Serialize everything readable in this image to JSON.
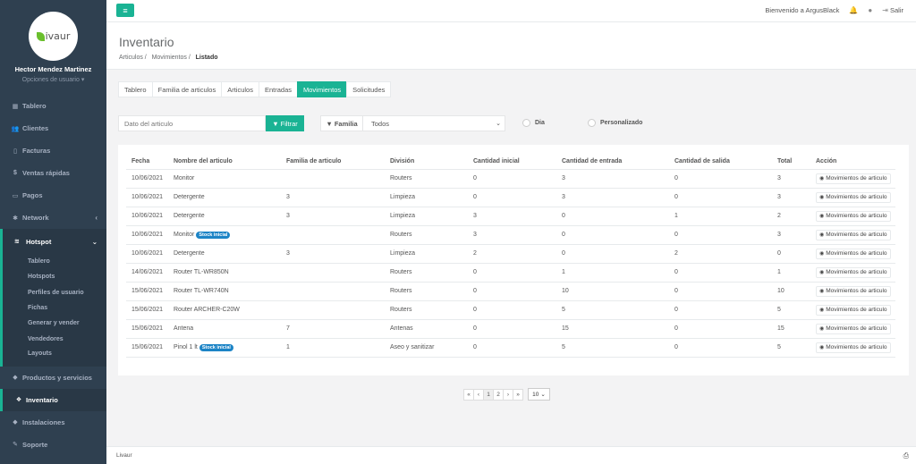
{
  "brand": {
    "logo_text": "ivaur",
    "footer_text": "Livaur"
  },
  "user": {
    "name": "Hector Mendez Martinez",
    "options": "Opciones de usuario"
  },
  "sidebar": {
    "items_top": [
      {
        "label": "Tablero",
        "icon": "dashboard-icon"
      },
      {
        "label": "Clientes",
        "icon": "users-icon"
      },
      {
        "label": "Facturas",
        "icon": "file-icon"
      },
      {
        "label": "Ventas rápidas",
        "icon": "dollar-icon"
      },
      {
        "label": "Pagos",
        "icon": "money-icon"
      },
      {
        "label": "Network",
        "icon": "network-icon"
      }
    ],
    "hotspot": {
      "label": "Hotspot",
      "sub_items": [
        "Tablero",
        "Hotspots",
        "Perfiles de usuario",
        "Fichas",
        "Generar y vender",
        "Vendedores",
        "Layouts"
      ]
    },
    "items_bottom": [
      {
        "label": "Productos y servicios",
        "icon": "tag-icon"
      },
      {
        "label": "Inventario",
        "icon": "cubes-icon",
        "active": true
      },
      {
        "label": "Instalaciones",
        "icon": "tag-icon"
      },
      {
        "label": "Soporte",
        "icon": "wrench-icon"
      }
    ]
  },
  "topbar": {
    "welcome": "Bienvenido a ArgusBlack",
    "logout": "Salir"
  },
  "header": {
    "title": "Inventario",
    "breadcrumb": [
      "Articulos",
      "Movimientos",
      "Listado"
    ]
  },
  "tabs": [
    {
      "label": "Tablero"
    },
    {
      "label": "Familia de articulos"
    },
    {
      "label": "Articulos"
    },
    {
      "label": "Entradas"
    },
    {
      "label": "Movimientos",
      "active": true
    },
    {
      "label": "Solicitudes"
    }
  ],
  "filters": {
    "search_placeholder": "Dato del articulo",
    "filter_button": "Filtrar",
    "family_label": "Familia",
    "family_value": "Todos",
    "radio_day": "Dia",
    "radio_custom": "Personalizado"
  },
  "table": {
    "columns": [
      "Fecha",
      "Nombre del articulo",
      "Familia de articulo",
      "División",
      "Cantidad inicial",
      "Cantidad de entrada",
      "Cantidad de salida",
      "Total",
      "Acción"
    ],
    "action_label": "Movimientos de articulo",
    "rows": [
      {
        "fecha": "10/06/2021",
        "nombre": "Monitor",
        "badge": "",
        "familia": "",
        "division": "Routers",
        "inicial": "0",
        "entrada": "3",
        "salida": "0",
        "total": "3"
      },
      {
        "fecha": "10/06/2021",
        "nombre": "Detergente",
        "badge": "",
        "familia": "3",
        "division": "Limpieza",
        "inicial": "0",
        "entrada": "3",
        "salida": "0",
        "total": "3"
      },
      {
        "fecha": "10/06/2021",
        "nombre": "Detergente",
        "badge": "",
        "familia": "3",
        "division": "Limpieza",
        "inicial": "3",
        "entrada": "0",
        "salida": "1",
        "total": "2"
      },
      {
        "fecha": "10/06/2021",
        "nombre": "Monitor",
        "badge": "Stock inicial",
        "familia": "",
        "division": "Routers",
        "inicial": "3",
        "entrada": "0",
        "salida": "0",
        "total": "3"
      },
      {
        "fecha": "10/06/2021",
        "nombre": "Detergente",
        "badge": "",
        "familia": "3",
        "division": "Limpieza",
        "inicial": "2",
        "entrada": "0",
        "salida": "2",
        "total": "0"
      },
      {
        "fecha": "14/06/2021",
        "nombre": "Router TL-WR850N",
        "badge": "",
        "familia": "",
        "division": "Routers",
        "inicial": "0",
        "entrada": "1",
        "salida": "0",
        "total": "1"
      },
      {
        "fecha": "15/06/2021",
        "nombre": "Router TL-WR740N",
        "badge": "",
        "familia": "",
        "division": "Routers",
        "inicial": "0",
        "entrada": "10",
        "salida": "0",
        "total": "10"
      },
      {
        "fecha": "15/06/2021",
        "nombre": "Router ARCHER-C20W",
        "badge": "",
        "familia": "",
        "division": "Routers",
        "inicial": "0",
        "entrada": "5",
        "salida": "0",
        "total": "5"
      },
      {
        "fecha": "15/06/2021",
        "nombre": "Antena",
        "badge": "",
        "familia": "7",
        "division": "Antenas",
        "inicial": "0",
        "entrada": "15",
        "salida": "0",
        "total": "15"
      },
      {
        "fecha": "15/06/2021",
        "nombre": "Pinol 1 lt",
        "badge": "Stock inicial",
        "familia": "1",
        "division": "Aseo y sanitizar",
        "inicial": "0",
        "entrada": "5",
        "salida": "0",
        "total": "5"
      }
    ]
  },
  "pagination": {
    "first": "«",
    "prev": "‹",
    "pages": [
      "1",
      "2"
    ],
    "current": "1",
    "next": "›",
    "last": "»",
    "page_size": "10"
  },
  "colors": {
    "accent": "#1ab394",
    "sidebar": "#2f4050",
    "badge": "#1c84c6"
  }
}
